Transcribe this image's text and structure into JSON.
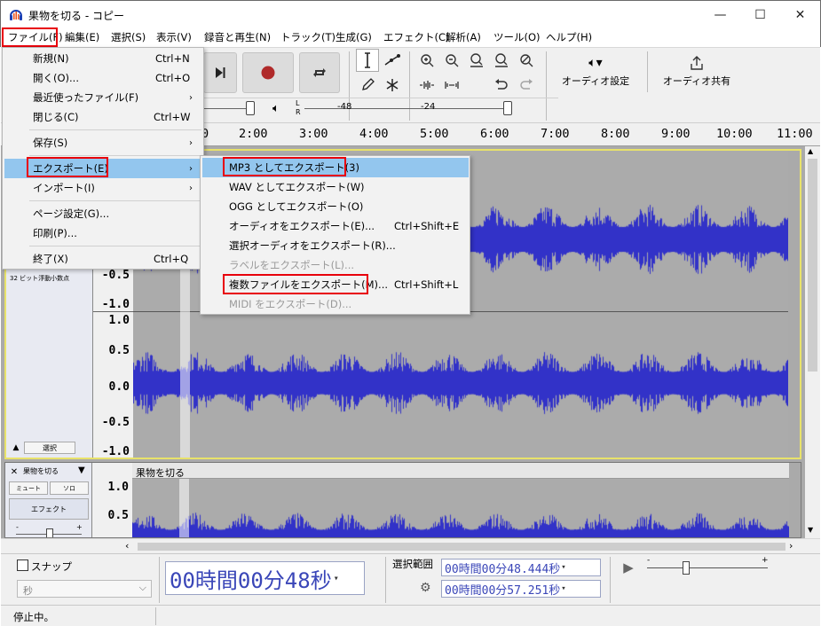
{
  "window": {
    "title": "果物を切る - コピー",
    "minimize_glyph": "—",
    "maximize_glyph": "☐",
    "close_glyph": "✕"
  },
  "menubar": [
    "ファイル(F)",
    "編集(E)",
    "選択(S)",
    "表示(V)",
    "録音と再生(N)",
    "トラック(T)",
    "生成(G)",
    "エフェクト(C)",
    "解析(A)",
    "ツール(O)",
    "ヘルプ(H)"
  ],
  "file_menu": [
    {
      "label": "新規(N)",
      "shortcut": "Ctrl+N"
    },
    {
      "label": "開く(O)...",
      "shortcut": "Ctrl+O"
    },
    {
      "label": "最近使ったファイル(F)",
      "arrow": "›"
    },
    {
      "label": "閉じる(C)",
      "shortcut": "Ctrl+W"
    },
    {
      "label": "保存(S)",
      "arrow": "›"
    },
    {
      "label": "エクスポート(E)",
      "arrow": "›"
    },
    {
      "label": "インポート(I)",
      "arrow": "›"
    },
    {
      "label": "ページ設定(G)..."
    },
    {
      "label": "印刷(P)..."
    },
    {
      "label": "終了(X)",
      "shortcut": "Ctrl+Q"
    }
  ],
  "export_menu": [
    {
      "label": "MP3 としてエクスポート(3)"
    },
    {
      "label": "WAV としてエクスポート(W)"
    },
    {
      "label": "OGG としてエクスポート(O)"
    },
    {
      "label": "オーディオをエクスポート(E)...",
      "shortcut": "Ctrl+Shift+E"
    },
    {
      "label": "選択オーディオをエクスポート(R)..."
    },
    {
      "label": "ラベルをエクスポート(L)...",
      "disabled": true
    },
    {
      "label": "複数ファイルをエクスポート(M)...",
      "shortcut": "Ctrl+Shift+L"
    },
    {
      "label": "MIDI をエクスポート(D)...",
      "disabled": true
    }
  ],
  "toolbar": {
    "audio_setup": "オーディオ設定",
    "audio_share": "オーディオ共有",
    "meter_lr": "L\nR",
    "meter_ticks": [
      "-48",
      "-24"
    ]
  },
  "ruler": {
    "ticks": [
      "0",
      "2:00",
      "3:00",
      "4:00",
      "5:00",
      "6:00",
      "7:00",
      "8:00",
      "9:00",
      "10:00",
      "11:00"
    ]
  },
  "track1": {
    "format_info": "32 ビット浮動小数点",
    "select_button": "選択",
    "scale_top": [
      "-0.5",
      "-1.0"
    ],
    "scale_bottom": [
      "1.0",
      "0.5",
      "0.0",
      "-0.5",
      "-1.0"
    ]
  },
  "track2": {
    "name": "果物を切る",
    "clip_title": "果物を切る",
    "mute": "ミュート",
    "solo": "ソロ",
    "effects": "エフェクト",
    "slider_minus": "-",
    "slider_plus": "+",
    "scale": [
      "1.0",
      "0.5"
    ]
  },
  "bottom": {
    "snap_label": "スナップ",
    "snap_unit": "秒",
    "time_display": "00時間00分48秒",
    "selection_label": "選択範囲",
    "sel_start": "00時間00分48.444秒",
    "sel_end": "00時間00分57.251秒",
    "play_minus": "-",
    "play_plus": "+"
  },
  "status": {
    "text": "停止中。"
  },
  "colors": {
    "waveform": "#3232c8",
    "highlight_box": "#e8000b",
    "menu_highlight": "#93c6ee",
    "time_text": "#3a46b8"
  }
}
